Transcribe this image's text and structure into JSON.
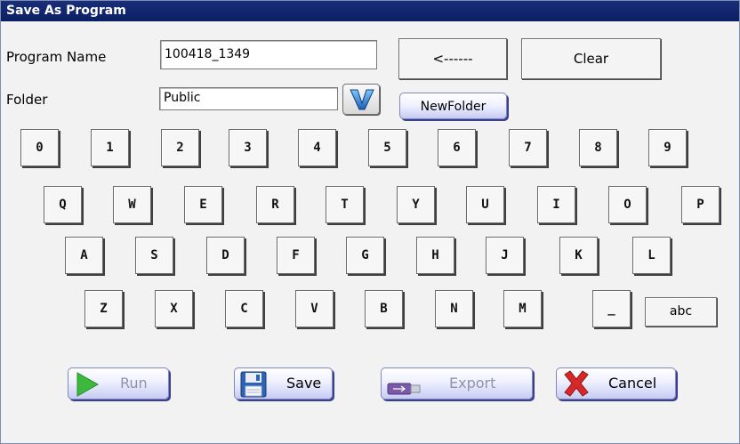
{
  "window": {
    "title": "Save As Program"
  },
  "form": {
    "program_name_label": "Program Name",
    "program_name_value": "100418_1349",
    "folder_label": "Folder",
    "folder_value": "Public",
    "backspace_label": "<------",
    "clear_label": "Clear",
    "newfolder_label": "NewFolder"
  },
  "keyboard": {
    "row1": [
      "0",
      "1",
      "2",
      "3",
      "4",
      "5",
      "6",
      "7",
      "8",
      "9"
    ],
    "row2": [
      "Q",
      "W",
      "E",
      "R",
      "T",
      "Y",
      "U",
      "I",
      "O",
      "P"
    ],
    "row3": [
      "A",
      "S",
      "D",
      "F",
      "G",
      "H",
      "J",
      "K",
      "L"
    ],
    "row4": [
      "Z",
      "X",
      "C",
      "V",
      "B",
      "N",
      "M",
      "_"
    ],
    "abc_label": "abc"
  },
  "actions": {
    "run_label": "Run",
    "save_label": "Save",
    "export_label": "Export",
    "cancel_label": "Cancel"
  },
  "icons": {
    "run": "play-icon",
    "save": "floppy-disk-icon",
    "export": "usb-drive-icon",
    "cancel": "red-x-icon",
    "dropdown": "v-chevron-icon"
  },
  "colors": {
    "titlebar": "#0a1e62",
    "button_gradient_bottom": "#c6cbf2",
    "disabled_text": "#8f93a8",
    "run_icon": "#3cb83c",
    "cancel_icon": "#d62828"
  },
  "state": {
    "run_enabled": false,
    "export_enabled": false
  }
}
